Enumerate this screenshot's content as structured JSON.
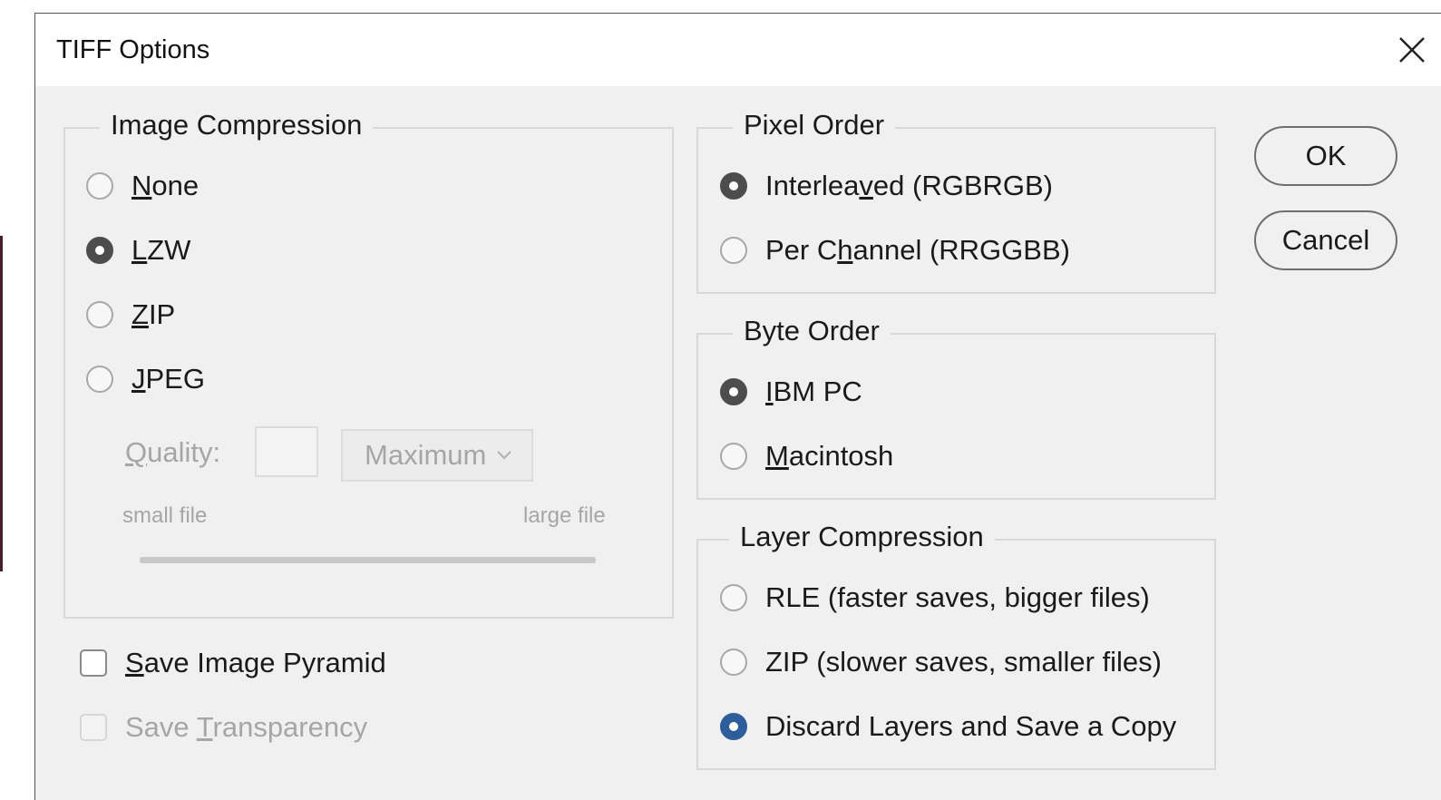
{
  "dialog": {
    "title": "TIFF Options"
  },
  "image_compression": {
    "legend": "Image Compression",
    "options": [
      {
        "pre": "",
        "ul": "N",
        "post": "one",
        "checked": false
      },
      {
        "pre": "",
        "ul": "L",
        "post": "ZW",
        "checked": true
      },
      {
        "pre": "",
        "ul": "Z",
        "post": "IP",
        "checked": false
      },
      {
        "pre": "",
        "ul": "J",
        "post": "PEG",
        "checked": false
      }
    ],
    "quality_label_ul": "Q",
    "quality_label_rest": "uality:",
    "quality_value": "",
    "quality_select": "Maximum",
    "slider_min_label": "small file",
    "slider_max_label": "large file"
  },
  "pixel_order": {
    "legend": "Pixel Order",
    "options": [
      {
        "pre": "Interlea",
        "ul": "v",
        "post": "ed (RGBRGB)",
        "checked": true
      },
      {
        "pre": "Per C",
        "ul": "h",
        "post": "annel (RRGGBB)",
        "checked": false
      }
    ]
  },
  "byte_order": {
    "legend": "Byte Order",
    "options": [
      {
        "pre": "",
        "ul": "I",
        "post": "BM PC",
        "checked": true
      },
      {
        "pre": "",
        "ul": "M",
        "post": "acintosh",
        "checked": false
      }
    ]
  },
  "layer_compression": {
    "legend": "Layer Compression",
    "options": [
      {
        "pre": "RLE (faster saves, bigger files)",
        "ul": "",
        "post": "",
        "checked": false
      },
      {
        "pre": "ZIP (slower saves, smaller files)",
        "ul": "",
        "post": "",
        "checked": false
      },
      {
        "pre": "Discard Layers and Save a Copy",
        "ul": "",
        "post": "",
        "checked": true
      }
    ]
  },
  "checkboxes": {
    "save_pyramid_ul": "S",
    "save_pyramid_rest": "ave Image Pyramid",
    "save_pyramid_checked": false,
    "save_transparency_pre": "Save ",
    "save_transparency_ul": "T",
    "save_transparency_rest": "ransparency",
    "save_transparency_checked": false
  },
  "buttons": {
    "ok": "OK",
    "cancel": "Cancel"
  },
  "colors": {
    "radio_checked": "#4d4d4d",
    "radio_checked_focus": "#2d5d9a",
    "dialog_bg": "#f0f0f0"
  }
}
